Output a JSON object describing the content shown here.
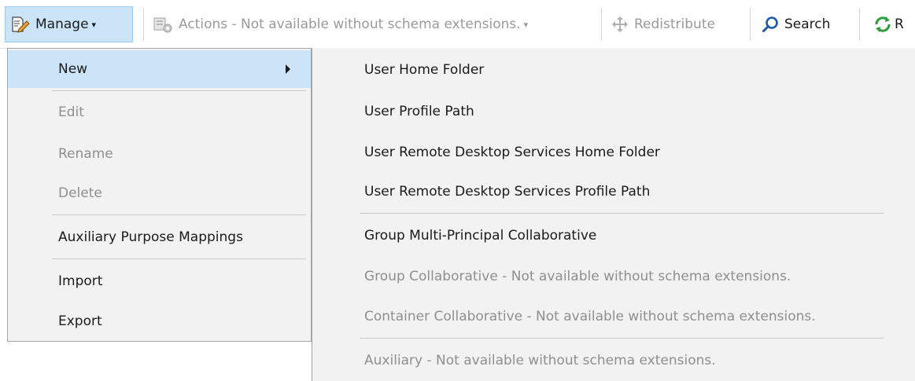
{
  "toolbar": {
    "manage_label": "Manage",
    "actions_label": "Actions - Not available without schema extensions.",
    "redistribute_label": "Redistribute",
    "search_label": "Search",
    "refresh_label": "R"
  },
  "menu": {
    "items": [
      {
        "label": "New",
        "state": "highlighted",
        "has_submenu": true
      },
      {
        "label": "Edit",
        "state": "disabled"
      },
      {
        "label": "Rename",
        "state": "disabled"
      },
      {
        "label": "Delete",
        "state": "disabled"
      },
      {
        "label": "Auxiliary Purpose Mappings",
        "state": "enabled"
      },
      {
        "label": "Import",
        "state": "enabled"
      },
      {
        "label": "Export",
        "state": "enabled"
      }
    ]
  },
  "submenu": {
    "items": [
      {
        "label": "User Home Folder",
        "state": "enabled"
      },
      {
        "label": "User Profile Path",
        "state": "enabled"
      },
      {
        "label": "User Remote Desktop Services Home Folder",
        "state": "enabled"
      },
      {
        "label": "User Remote Desktop Services Profile Path",
        "state": "enabled"
      },
      {
        "label": "Group Multi-Principal Collaborative",
        "state": "enabled"
      },
      {
        "label": "Group Collaborative - Not available without schema extensions.",
        "state": "disabled"
      },
      {
        "label": "Container Collaborative - Not available without schema extensions.",
        "state": "disabled"
      },
      {
        "label": "Auxiliary - Not available without schema extensions.",
        "state": "disabled"
      }
    ]
  },
  "colors": {
    "highlight": "#cce4f7",
    "menu_background": "#f2f2f2",
    "disabled_text": "#8f8f8f",
    "search_icon": "#1f5aa6",
    "refresh_icon": "#2e9e3a"
  },
  "icons": {
    "manage": "edit-document-icon",
    "actions": "actions-gear-icon",
    "redistribute": "redistribute-arrows-icon",
    "search": "search-icon",
    "refresh": "refresh-icon",
    "submenu_arrow": "chevron-right-icon"
  }
}
